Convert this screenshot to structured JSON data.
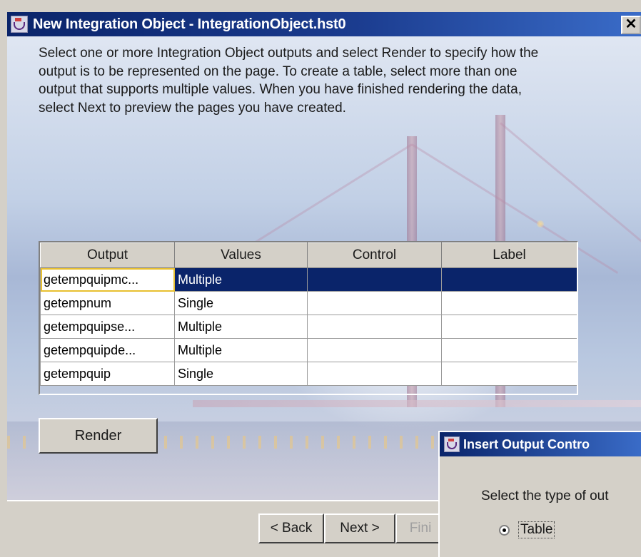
{
  "window": {
    "title": "New Integration Object - IntegrationObject.hst0",
    "close_label": "✕",
    "title_icon": "java-cup-icon"
  },
  "instructions": "Select one or more Integration Object outputs and select Render to specify how the output is to be represented on the page. To create a table, select more than one output that supports multiple values. When you have finished rendering the data, select Next to preview the pages you have created.",
  "table": {
    "columns": [
      "Output",
      "Values",
      "Control",
      "Label"
    ],
    "rows": [
      {
        "output": "getempquipmc...",
        "values": "Multiple",
        "control": "",
        "label": "",
        "selected": true
      },
      {
        "output": "getempnum",
        "values": "Single",
        "control": "",
        "label": ""
      },
      {
        "output": "getempquipse...",
        "values": "Multiple",
        "control": "",
        "label": ""
      },
      {
        "output": "getempquipde...",
        "values": "Multiple",
        "control": "",
        "label": ""
      },
      {
        "output": "getempquip",
        "values": "Single",
        "control": "",
        "label": ""
      }
    ]
  },
  "buttons": {
    "render": "Render",
    "back": "< Back",
    "next": "Next >",
    "finish": "Fini"
  },
  "dialog": {
    "title": "Insert Output Contro",
    "prompt": "Select the type of out",
    "radio_label": "Table",
    "radio_selected": true
  },
  "colors": {
    "title_bar": "#0a246a",
    "selection": "#0a246a",
    "face": "#d4d0c8"
  }
}
